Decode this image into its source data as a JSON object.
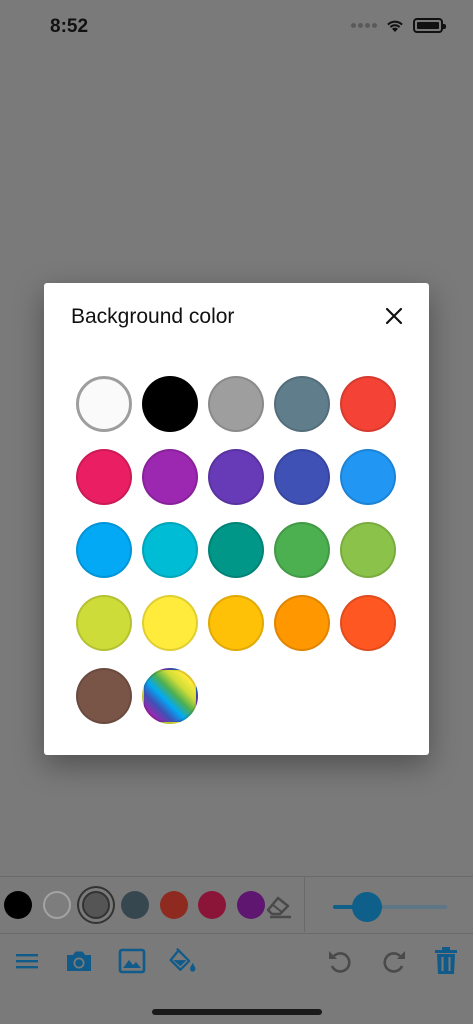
{
  "status_bar": {
    "time": "8:52"
  },
  "dialog": {
    "title": "Background color",
    "close_icon": "close-icon",
    "swatches": [
      {
        "name": "white",
        "color": "#fafafa"
      },
      {
        "name": "black",
        "color": "#000000"
      },
      {
        "name": "grey",
        "color": "#9e9e9e"
      },
      {
        "name": "blue-grey",
        "color": "#607d8b"
      },
      {
        "name": "red",
        "color": "#f44336"
      },
      {
        "name": "pink",
        "color": "#e91e63"
      },
      {
        "name": "purple",
        "color": "#9c27b0"
      },
      {
        "name": "deep-purple",
        "color": "#673ab7"
      },
      {
        "name": "indigo",
        "color": "#3f51b5"
      },
      {
        "name": "blue",
        "color": "#2196f3"
      },
      {
        "name": "light-blue",
        "color": "#03a9f4"
      },
      {
        "name": "cyan",
        "color": "#00bcd4"
      },
      {
        "name": "teal",
        "color": "#009688"
      },
      {
        "name": "green",
        "color": "#4caf50"
      },
      {
        "name": "light-green",
        "color": "#8bc34a"
      },
      {
        "name": "lime",
        "color": "#cddc39"
      },
      {
        "name": "yellow",
        "color": "#ffeb3b"
      },
      {
        "name": "amber",
        "color": "#ffc107"
      },
      {
        "name": "orange",
        "color": "#ff9800"
      },
      {
        "name": "deep-orange",
        "color": "#ff5722"
      },
      {
        "name": "brown",
        "color": "#795548"
      },
      {
        "name": "rainbow",
        "color": "gradient"
      }
    ]
  },
  "toolbar": {
    "palette": [
      {
        "name": "black",
        "color": "#000000"
      },
      {
        "name": "white",
        "color": "#7d7d7d"
      },
      {
        "name": "grey",
        "color": "#555555",
        "selected": true
      },
      {
        "name": "blue-grey",
        "color": "#37474f"
      },
      {
        "name": "red",
        "color": "#8e2a20"
      },
      {
        "name": "pink",
        "color": "#8a1538"
      },
      {
        "name": "purple",
        "color": "#5e1670"
      }
    ],
    "stroke_width": 0.3,
    "actions": [
      {
        "name": "menu-icon"
      },
      {
        "name": "camera-icon"
      },
      {
        "name": "image-icon"
      },
      {
        "name": "paint-bucket-icon"
      },
      {
        "name": "undo-icon"
      },
      {
        "name": "redo-icon"
      },
      {
        "name": "trash-icon"
      }
    ]
  },
  "colors": {
    "accent": "#0e5f8a",
    "icon_blue": "#105b8a",
    "icon_disabled": "#4a4a4a"
  }
}
